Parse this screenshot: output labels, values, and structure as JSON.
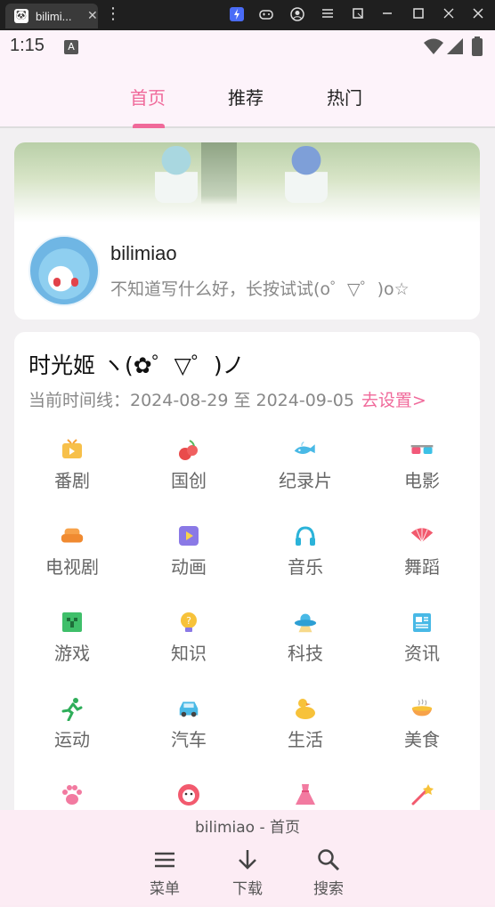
{
  "browser": {
    "tab_title": "bilimi...",
    "tab_close": "✕",
    "favicon": "🐼",
    "menu_glyph": "⋮"
  },
  "status": {
    "time": "1:15",
    "badge": "A"
  },
  "top_tabs": [
    {
      "label": "首页",
      "active": true
    },
    {
      "label": "推荐",
      "active": false
    },
    {
      "label": "热门",
      "active": false
    }
  ],
  "profile": {
    "username": "bilimiao",
    "motto": "不知道写什么好，长按试试(o゜▽゜)o☆"
  },
  "section": {
    "title": "时光姬 ヽ(✿゜▽゜)ノ",
    "timeline_prefix": "当前时间线：2024-08-29 至 2024-09-05",
    "set_link": "去设置>"
  },
  "categories": [
    {
      "label": "番剧",
      "icon": "tv-icon"
    },
    {
      "label": "国创",
      "icon": "cherry-icon"
    },
    {
      "label": "纪录片",
      "icon": "whale-icon"
    },
    {
      "label": "电影",
      "icon": "3d-glasses-icon"
    },
    {
      "label": "电视剧",
      "icon": "sofa-icon"
    },
    {
      "label": "动画",
      "icon": "play-icon"
    },
    {
      "label": "音乐",
      "icon": "headphones-icon"
    },
    {
      "label": "舞蹈",
      "icon": "fan-icon"
    },
    {
      "label": "游戏",
      "icon": "creeper-icon"
    },
    {
      "label": "知识",
      "icon": "lightbulb-icon"
    },
    {
      "label": "科技",
      "icon": "ufo-icon"
    },
    {
      "label": "资讯",
      "icon": "newspaper-icon"
    },
    {
      "label": "运动",
      "icon": "runner-icon"
    },
    {
      "label": "汽车",
      "icon": "car-icon"
    },
    {
      "label": "生活",
      "icon": "duck-icon"
    },
    {
      "label": "美食",
      "icon": "dish-icon"
    },
    {
      "label": "",
      "icon": "paw-icon"
    },
    {
      "label": "",
      "icon": "pig-face-icon"
    },
    {
      "label": "",
      "icon": "dress-icon"
    },
    {
      "label": "",
      "icon": "magic-wand-icon"
    }
  ],
  "bottom": {
    "caption": "bilimiao - 首页",
    "menu": "菜单",
    "download": "下载",
    "search": "搜索"
  },
  "colors": {
    "accent": "#f0699a",
    "card": "#ffffff",
    "background": "#f2f0f2"
  }
}
